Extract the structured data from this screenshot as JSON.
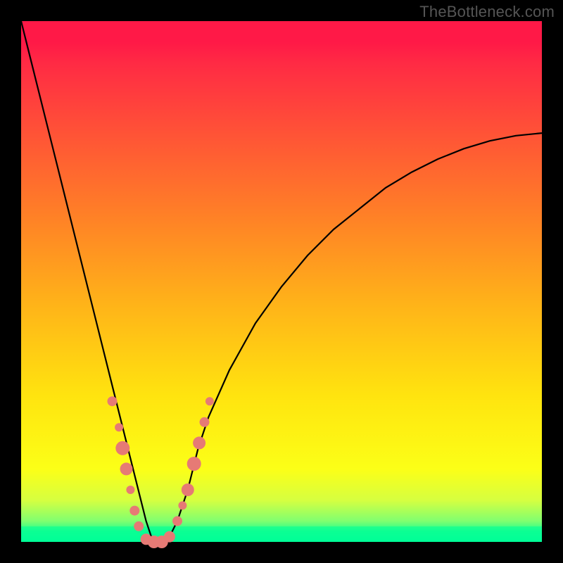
{
  "watermark": "TheBottleneck.com",
  "colors": {
    "top": "#ff1947",
    "mid": "#ffe40f",
    "bottom": "#00ff98",
    "curve": "#000000",
    "markers": "#e67a75",
    "frame": "#000000"
  },
  "chart_data": {
    "type": "line",
    "title": "",
    "xlabel": "",
    "ylabel": "",
    "xlim": [
      0,
      100
    ],
    "ylim": [
      0,
      100
    ],
    "grid": false,
    "legend": false,
    "series": [
      {
        "name": "bottleneck-curve",
        "x": [
          0,
          2,
          4,
          6,
          8,
          10,
          12,
          14,
          16,
          18,
          20,
          22,
          24,
          25,
          26,
          28,
          30,
          32,
          34,
          36,
          40,
          45,
          50,
          55,
          60,
          65,
          70,
          75,
          80,
          85,
          90,
          95,
          100
        ],
        "y": [
          100,
          92,
          84,
          76,
          68,
          60,
          52,
          44,
          36,
          28,
          20,
          12,
          4,
          1,
          0,
          0,
          4,
          10,
          18,
          24,
          33,
          42,
          49,
          55,
          60,
          64,
          68,
          71,
          73.5,
          75.5,
          77,
          78,
          78.5
        ]
      }
    ],
    "markers": [
      {
        "x": 17.5,
        "y": 27,
        "r": 7
      },
      {
        "x": 18.8,
        "y": 22,
        "r": 6
      },
      {
        "x": 19.5,
        "y": 18,
        "r": 10
      },
      {
        "x": 20.2,
        "y": 14,
        "r": 9
      },
      {
        "x": 21.0,
        "y": 10,
        "r": 6
      },
      {
        "x": 21.8,
        "y": 6,
        "r": 7
      },
      {
        "x": 22.6,
        "y": 3,
        "r": 7
      },
      {
        "x": 24.0,
        "y": 0.5,
        "r": 8
      },
      {
        "x": 25.5,
        "y": 0,
        "r": 9
      },
      {
        "x": 27.0,
        "y": 0,
        "r": 9
      },
      {
        "x": 28.5,
        "y": 1,
        "r": 8
      },
      {
        "x": 30.0,
        "y": 4,
        "r": 7
      },
      {
        "x": 31.0,
        "y": 7,
        "r": 6
      },
      {
        "x": 32.0,
        "y": 10,
        "r": 9
      },
      {
        "x": 33.2,
        "y": 15,
        "r": 10
      },
      {
        "x": 34.2,
        "y": 19,
        "r": 9
      },
      {
        "x": 35.2,
        "y": 23,
        "r": 7
      },
      {
        "x": 36.2,
        "y": 27,
        "r": 6
      }
    ],
    "green_band": {
      "y_from": 0,
      "y_to": 3
    }
  }
}
